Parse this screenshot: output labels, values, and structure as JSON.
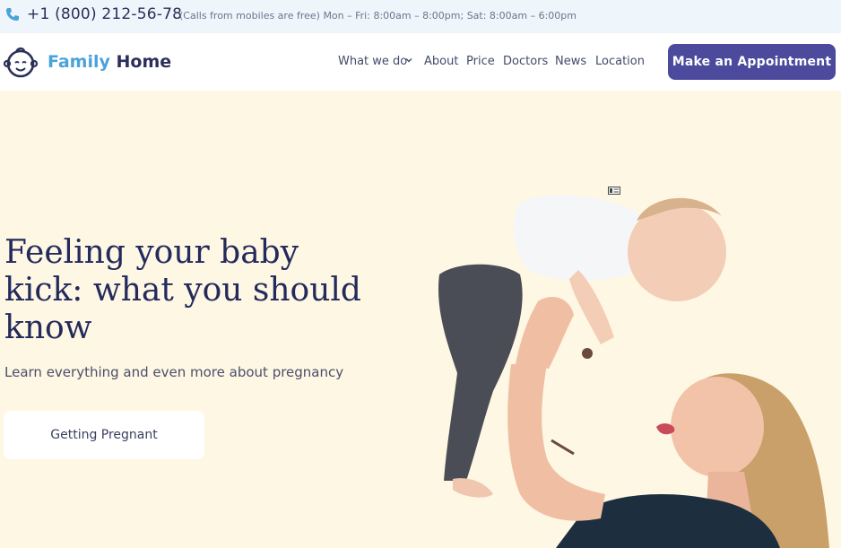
{
  "topbar": {
    "phone_icon": "phone-icon",
    "phone": "+1 (800) 212-56-78",
    "hours": "(Calls from mobiles are free) Mon – Fri: 8:00am – 8:00pm; Sat: 8:00am – 6:00pm"
  },
  "logo": {
    "icon": "baby-face-icon",
    "name_part1": "Family",
    "name_part2": "Home"
  },
  "nav": {
    "items": [
      "What we do",
      "About",
      "Price",
      "Doctors",
      "News",
      "Location"
    ],
    "cta": "Make an Appointment"
  },
  "hero": {
    "title": "Feeling your baby kick: what you should know",
    "subtitle": "Learn everything and even more about pregnancy",
    "button": "Getting Pregnant"
  },
  "colors": {
    "accent": "#4b4a9c",
    "brand_blue": "#4aa3d9",
    "hero_bg": "#fef7e4",
    "dark_text": "#232a5c"
  }
}
